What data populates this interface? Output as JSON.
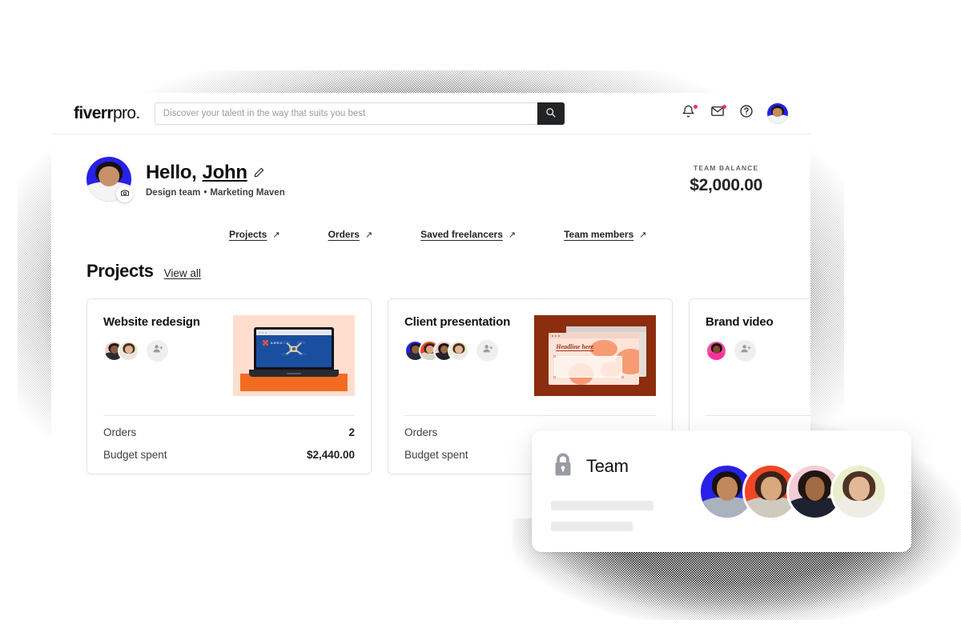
{
  "window": {
    "topbar": {
      "logo_bold": "fiverr",
      "logo_normal": "pro.",
      "search_placeholder": "Discover your talent in the way that suits you best",
      "search_value": "",
      "search_icon": "search-icon",
      "notifications_icon": "bell-icon",
      "messages_icon": "envelope-icon",
      "help_icon": "question-circle-icon",
      "avatar_icon": "user-avatar"
    },
    "greeting": {
      "hello_prefix": "Hello,",
      "name": "John",
      "edit_icon": "pencil-icon",
      "camera_icon": "camera-icon",
      "team": "Design team",
      "separator": "•",
      "role": "Marketing Maven"
    },
    "balance": {
      "label": "TEAM BALANCE",
      "amount": "$2,000.00"
    },
    "nav_links": [
      {
        "label": "Projects",
        "arrow": "↗"
      },
      {
        "label": "Orders",
        "arrow": "↗"
      },
      {
        "label": "Saved freelancers",
        "arrow": "↗"
      },
      {
        "label": "Team members",
        "arrow": "↗"
      }
    ],
    "section": {
      "title": "Projects",
      "view_all": "View all"
    },
    "project_cards": [
      {
        "title": "Website redesign",
        "members": 2,
        "add_icon": "add-person-icon",
        "thumb": "laptop-drone-photo",
        "thumb_logo": "AREO",
        "stats": [
          {
            "key": "Orders",
            "value": "2"
          },
          {
            "key": "Budget spent",
            "value": "$2,440.00"
          }
        ]
      },
      {
        "title": "Client presentation",
        "members": 4,
        "add_icon": "add-person-icon",
        "thumb": "presentation-mockup",
        "thumb_headline": "Headline here",
        "stats": [
          {
            "key": "Orders",
            "value": ""
          },
          {
            "key": "Budget spent",
            "value": ""
          }
        ]
      },
      {
        "title": "Brand video",
        "members": 1,
        "add_icon": "add-person-icon",
        "thumb": "",
        "stats": [
          {
            "key": "",
            "value": ""
          },
          {
            "key": "",
            "value": ""
          }
        ]
      }
    ]
  },
  "team_card": {
    "lock_icon": "lock-icon",
    "title": "Team",
    "avatars": 4
  },
  "colors": {
    "accent_dark": "#222325",
    "badge_pink": "#ff2e74",
    "avatar_blue": "#2720e8",
    "avatar_orange": "#f04624",
    "avatar_pink": "#f2cdd6",
    "avatar_lime": "#e9eecd",
    "laptop_bg": "#ffded0",
    "laptop_block": "#f26b21",
    "presentation_bg": "#8c2d10",
    "skeleton": "#ebebec"
  }
}
